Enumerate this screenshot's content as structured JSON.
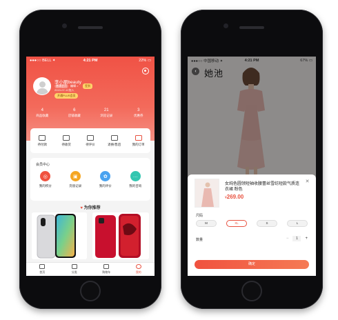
{
  "left": {
    "status": {
      "carrier": "●●●○○ BELL ✦",
      "time": "4:21 PM",
      "battery": "22% ▭"
    },
    "profile": {
      "name": "李小丽beauty",
      "tag_level": "普通会员",
      "tag_extra": "编辑 >",
      "date": "2019-07-12加入",
      "edit_label": "签到",
      "vip_label": "开通PLUS会员"
    },
    "stats": [
      {
        "num": "4",
        "label": "商品收藏"
      },
      {
        "num": "6",
        "label": "店铺收藏"
      },
      {
        "num": "21",
        "label": "浏览记录"
      },
      {
        "num": "3",
        "label": "优惠券"
      }
    ],
    "orders": [
      {
        "label": "待付款"
      },
      {
        "label": "待收货"
      },
      {
        "label": "待评价"
      },
      {
        "label": "退换/售后"
      },
      {
        "label": "我的订单"
      }
    ],
    "members": {
      "title": "会员中心",
      "items": [
        {
          "label": "我的积分",
          "color": "#f0523f",
          "glyph": "◎"
        },
        {
          "label": "充值记录",
          "color": "#f5a623",
          "glyph": "▣"
        },
        {
          "label": "我的评价",
          "color": "#4aa3f0",
          "glyph": "✿"
        },
        {
          "label": "我的咨询",
          "color": "#33c6b0",
          "glyph": "…"
        }
      ]
    },
    "recommend_title": "为你推荐",
    "tabs": [
      {
        "label": "首页"
      },
      {
        "label": "分类"
      },
      {
        "label": "购物车"
      },
      {
        "label": "我的"
      }
    ]
  },
  "right": {
    "status": {
      "carrier": "●●●○○ 中国移动 ✦",
      "time": "4:21 PM",
      "battery": "67% ▭"
    },
    "brand": "她池",
    "product": {
      "name": "女纯色圆领短袖收腰蕾丝雪纺短款气质连衣裙 粉色",
      "price": "269.00",
      "currency": "¥",
      "thumb_tag": "她池"
    },
    "size_label": "尺码",
    "sizes": [
      "M",
      "XL",
      "S",
      "L"
    ],
    "selected_size": "XL",
    "qty_label": "数量",
    "qty": "1",
    "confirm_label": "确定"
  }
}
